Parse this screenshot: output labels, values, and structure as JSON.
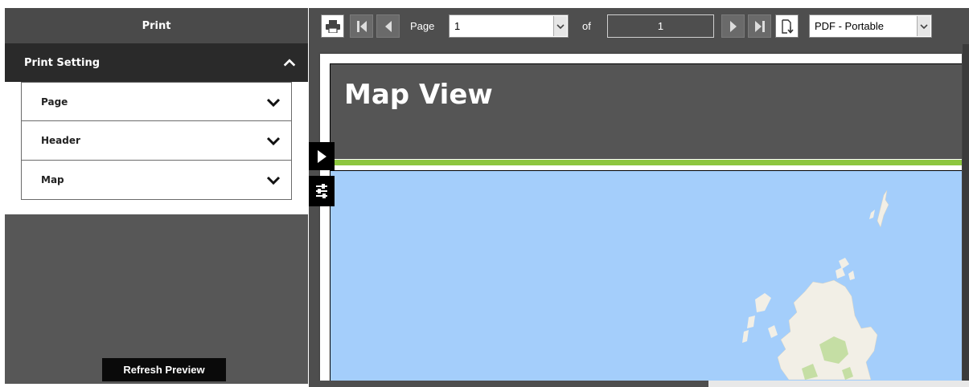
{
  "sidebar": {
    "title": "Print",
    "section": {
      "label": "Print Setting"
    },
    "items": [
      {
        "label": "Page"
      },
      {
        "label": "Header"
      },
      {
        "label": "Map"
      }
    ],
    "refresh_label": "Refresh Preview"
  },
  "toolbar": {
    "page_label": "Page",
    "page_value": "1",
    "of_label": "of",
    "total_pages": "1",
    "format_value": "PDF - Portable"
  },
  "report": {
    "title": "Map View"
  },
  "colors": {
    "accent_green": "#8dc63f",
    "header_gray": "#555555",
    "sea_blue": "#a4cefb",
    "land": "#f2efe6",
    "park_green": "#c5dea4"
  },
  "icons": {
    "print": "printer-icon",
    "first": "first-page-icon",
    "prev": "previous-page-icon",
    "next": "next-page-icon",
    "last": "last-page-icon",
    "export": "export-icon",
    "collapse": "chevron-up-icon",
    "expand": "chevron-down-icon",
    "toggle": "play-arrow-icon",
    "settings": "sliders-icon"
  }
}
